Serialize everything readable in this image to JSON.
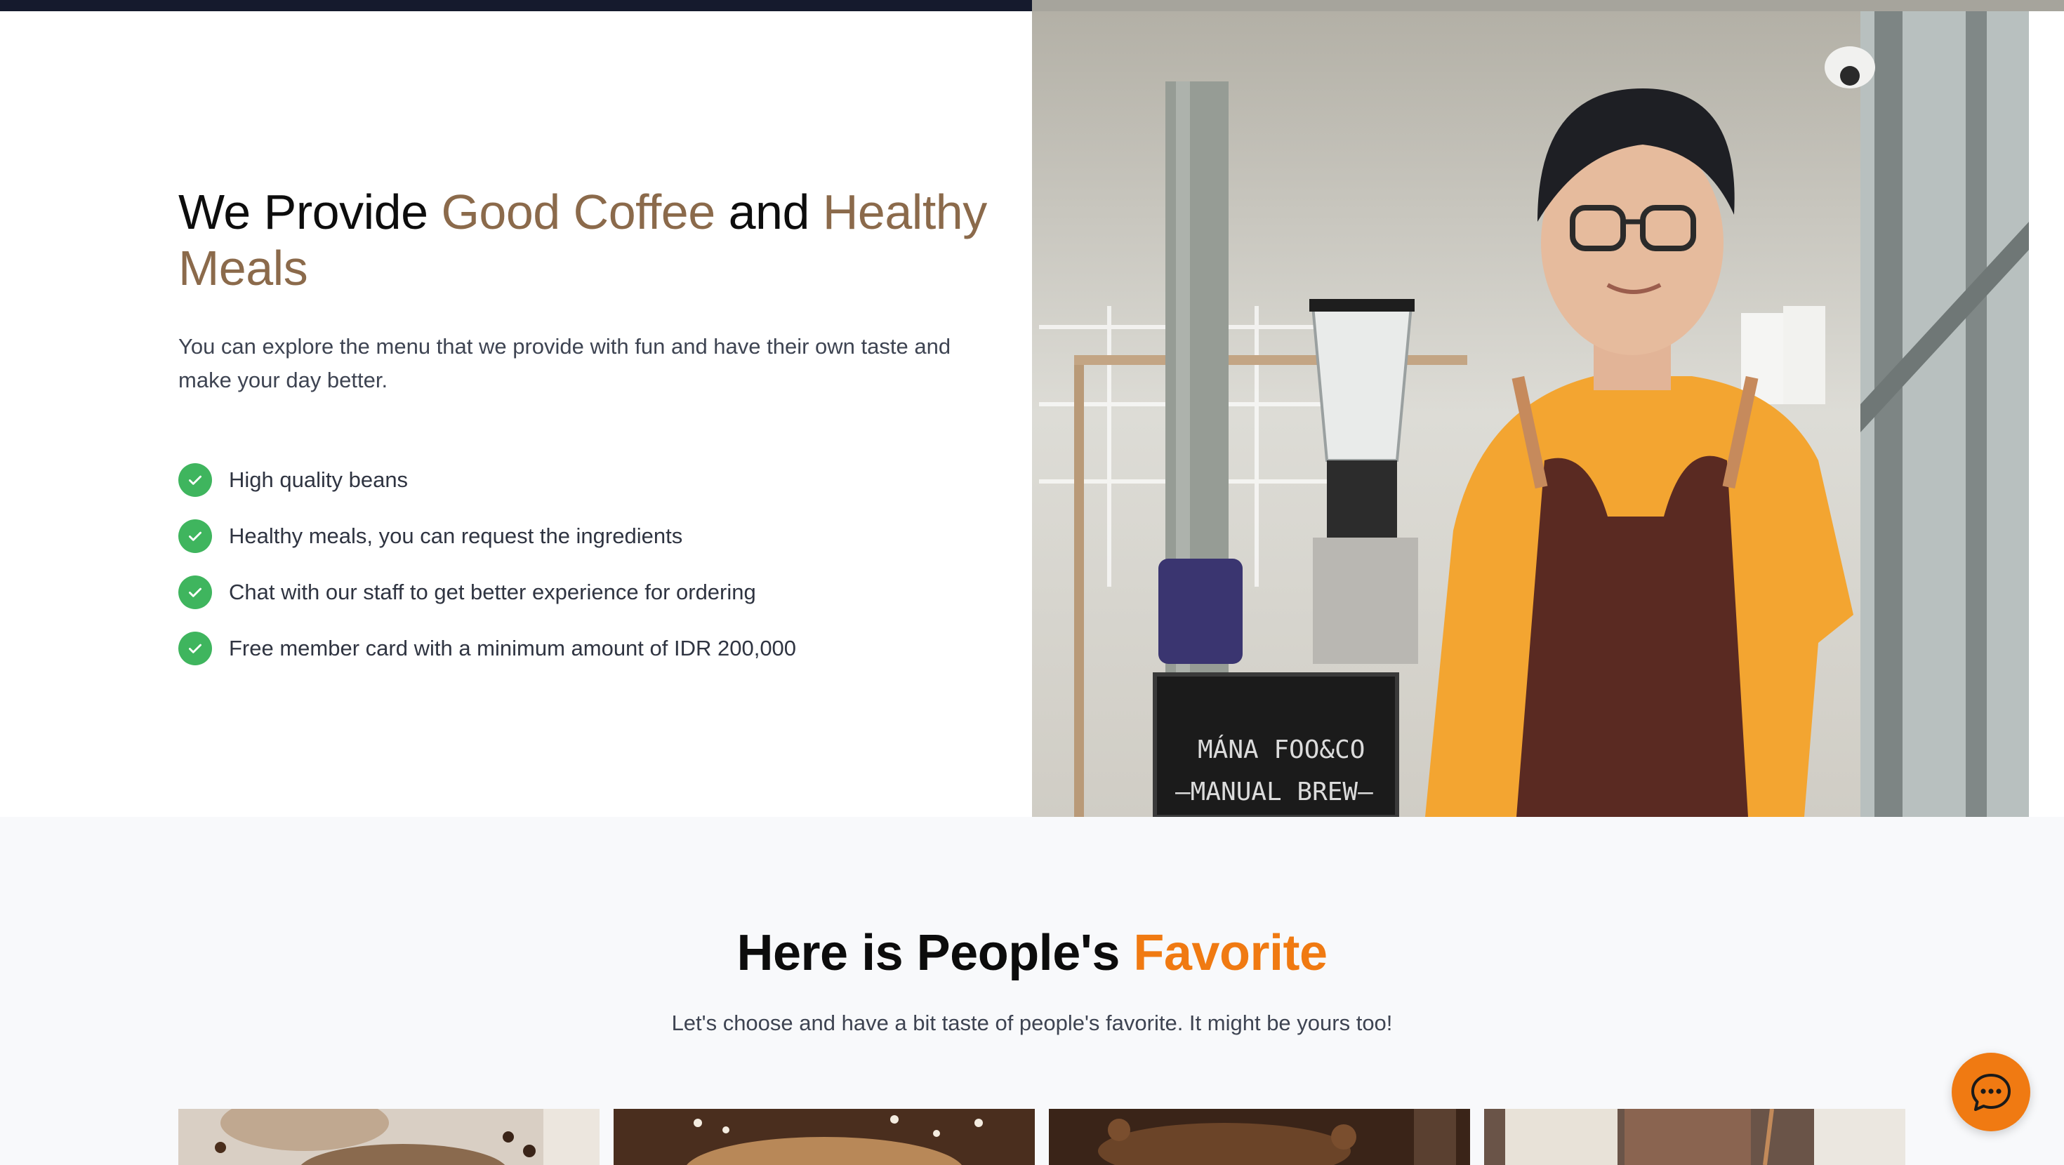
{
  "hero": {
    "title_part1": "We Provide ",
    "title_accent1": "Good Coffee",
    "title_part2": " and ",
    "title_accent2": "Healthy Meals",
    "description": "You can explore the menu that we provide with fun and have their own taste and make your day better.",
    "features": [
      {
        "label": "High quality beans",
        "icon": "check-circle-icon"
      },
      {
        "label": "Healthy meals, you can request the ingredients",
        "icon": "check-circle-icon"
      },
      {
        "label": "Chat with our staff to get better experience for ordering",
        "icon": "check-circle-icon"
      },
      {
        "label": "Free member card with a minimum amount of IDR 200,000",
        "icon": "check-circle-icon"
      }
    ],
    "photo_sign_line1": "MÁNA FOO&CO",
    "photo_sign_line2": "—MANUAL BREW—"
  },
  "favorites": {
    "title_part1": "Here is People's ",
    "title_accent": "Favorite",
    "description": "Let's choose and have a bit taste of people's favorite. It might be yours too!"
  },
  "chat": {
    "icon": "chat-bubble-icon"
  },
  "colors": {
    "accent_brown": "#8b6a4b",
    "accent_orange": "#f07a12",
    "check_green": "#3fb55e",
    "topbar_dark": "#151a2d",
    "section_bg": "#f8f9fb"
  }
}
